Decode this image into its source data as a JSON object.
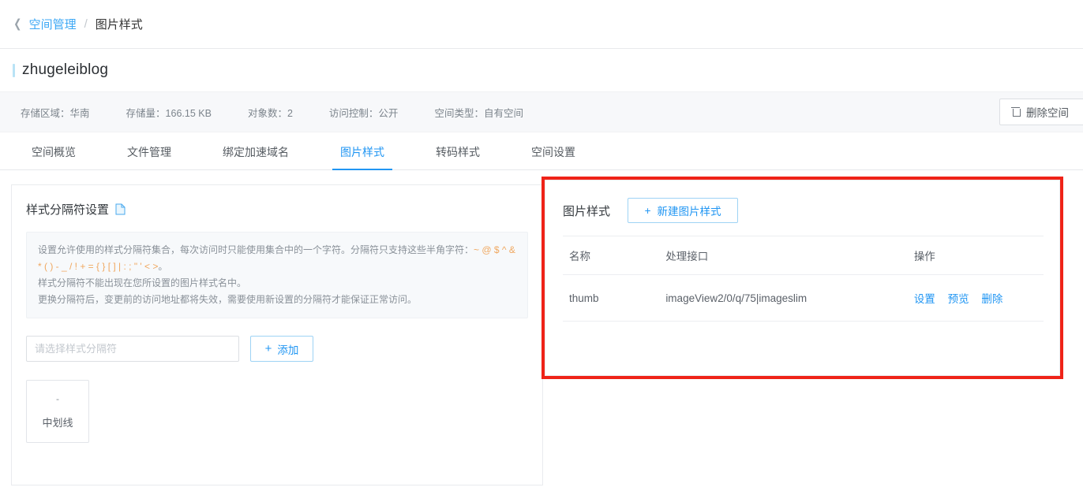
{
  "breadcrumb": {
    "back_icon": "chevron-left-icon",
    "parent": "空间管理",
    "separator": "/",
    "current": "图片样式"
  },
  "bucket": {
    "name": "zhugeleiblog",
    "accent_color": "#b9e3f6"
  },
  "info_bar": {
    "items": [
      {
        "label": "存储区域：",
        "value": "华南"
      },
      {
        "label": "存储量：",
        "value": "166.15 KB"
      },
      {
        "label": "对象数：",
        "value": "2"
      },
      {
        "label": "访问控制：",
        "value": "公开"
      },
      {
        "label": "空间类型：",
        "value": "自有空间"
      }
    ],
    "delete_button": {
      "label": "删除空间",
      "icon": "trash-icon"
    }
  },
  "tabs": {
    "active_index": 3,
    "items": [
      {
        "label": "空间概览"
      },
      {
        "label": "文件管理"
      },
      {
        "label": "绑定加速域名"
      },
      {
        "label": "图片样式"
      },
      {
        "label": "转码样式"
      },
      {
        "label": "空间设置"
      }
    ],
    "active_color": "#2196f3"
  },
  "separator_panel": {
    "title": "样式分隔符设置",
    "doc_icon": "document-icon",
    "notice": {
      "line1_prefix": "设置允许使用的样式分隔符集合，每次访问时只能使用集合中的一个字符。分隔符只支持这些半角字符：",
      "line1_chars": "~ @ $ ^ &",
      "line2_chars": "* ( ) - _ / ! + = { } [ ] | : ; \" ' < >",
      "line2_suffix": "。",
      "line3": "样式分隔符不能出现在您所设置的图片样式名中。",
      "line4": "更换分隔符后，变更前的访问地址都将失效，需要使用新设置的分隔符才能保证正常访问。",
      "chars_color": "#f0a860"
    },
    "input": {
      "placeholder": "请选择样式分隔符",
      "value": ""
    },
    "add_button": {
      "label": "添加",
      "icon": "plus-icon"
    },
    "chips": [
      {
        "glyph": "-",
        "name": "中划线"
      }
    ]
  },
  "image_style_panel": {
    "highlight_color": "#ef2318",
    "title": "图片样式",
    "new_button": {
      "label": "新建图片样式",
      "icon": "plus-icon"
    },
    "table": {
      "columns": [
        "名称",
        "处理接口",
        "操作"
      ],
      "rows": [
        {
          "name": "thumb",
          "api": "imageView2/0/q/75|imageslim",
          "actions": [
            "设置",
            "预览",
            "删除"
          ]
        }
      ]
    }
  }
}
